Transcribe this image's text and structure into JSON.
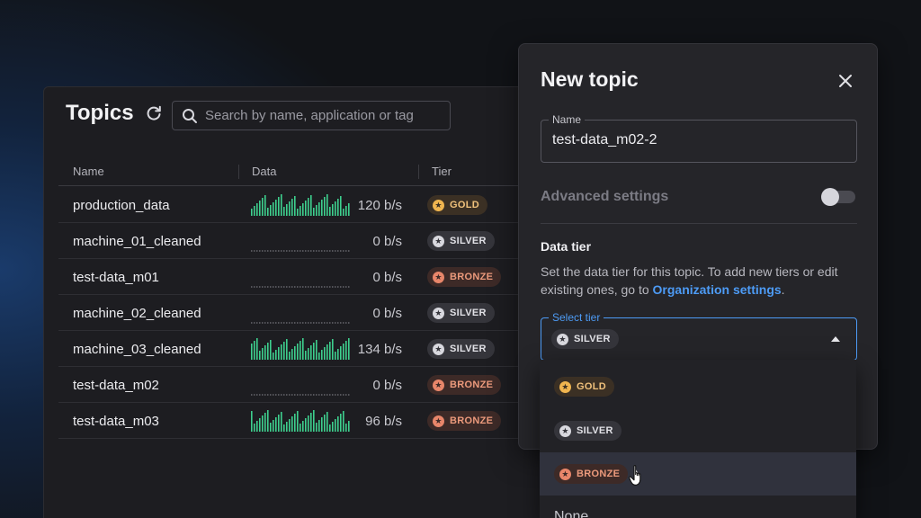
{
  "topics": {
    "title": "Topics",
    "search_placeholder": "Search by name, application or tag",
    "columns": [
      "Name",
      "Data",
      "Tier"
    ],
    "rows": [
      {
        "name": "production_data",
        "rate": "120 b/s",
        "tier": "GOLD",
        "active": true
      },
      {
        "name": "machine_01_cleaned",
        "rate": "0 b/s",
        "tier": "SILVER",
        "active": false
      },
      {
        "name": "test-data_m01",
        "rate": "0 b/s",
        "tier": "BRONZE",
        "active": false
      },
      {
        "name": "machine_02_cleaned",
        "rate": "0 b/s",
        "tier": "SILVER",
        "active": false
      },
      {
        "name": "machine_03_cleaned",
        "rate": "134 b/s",
        "tier": "SILVER",
        "active": true
      },
      {
        "name": "test-data_m02",
        "rate": "0 b/s",
        "tier": "BRONZE",
        "active": false
      },
      {
        "name": "test-data_m03",
        "rate": "96 b/s",
        "tier": "BRONZE",
        "active": true
      }
    ]
  },
  "new_topic": {
    "title": "New topic",
    "name_label": "Name",
    "name_value": "test-data_m02-2",
    "advanced_label": "Advanced settings",
    "advanced_enabled": false,
    "data_tier_title": "Data tier",
    "data_tier_desc": "Set the data tier for this topic. To add new tiers or edit existing ones, go to ",
    "data_tier_link": "Organization settings",
    "data_tier_period": ".",
    "select_label": "Select tier",
    "selected_tier": "SILVER",
    "options": [
      "GOLD",
      "SILVER",
      "BRONZE",
      "None"
    ],
    "hovered_option": "BRONZE"
  },
  "colors": {
    "accent": "#4d9bf5",
    "spark": "#3ecf8e",
    "gold": "#f0b54f",
    "silver": "#d8d8de",
    "bronze": "#e8866a"
  }
}
